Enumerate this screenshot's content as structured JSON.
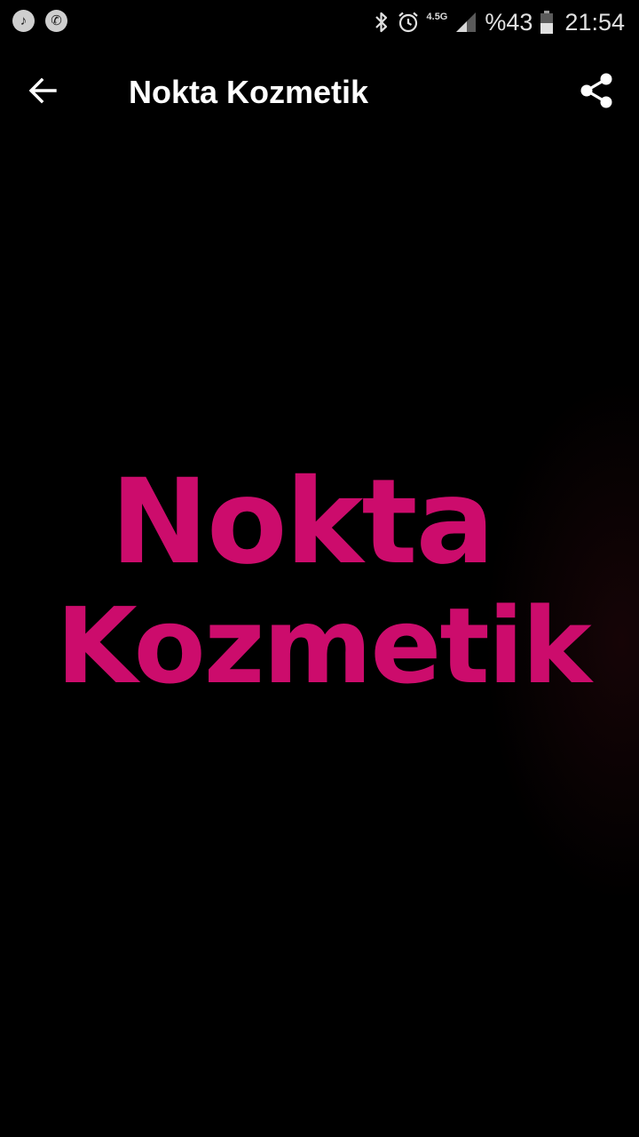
{
  "status_bar": {
    "left_icons": [
      "music-note-icon",
      "phone-call-icon"
    ],
    "network_label": "4.5G",
    "battery": "%43",
    "time": "21:54"
  },
  "app_bar": {
    "title": "Nokta Kozmetik",
    "back_icon": "arrow-back-icon",
    "share_icon": "share-icon"
  },
  "content": {
    "logo_line_1": "Nokta",
    "logo_line_2": "Kozmetik"
  },
  "colors": {
    "background": "#000000",
    "logo_pink": "#cc0c6c",
    "foreground": "#ffffff"
  }
}
